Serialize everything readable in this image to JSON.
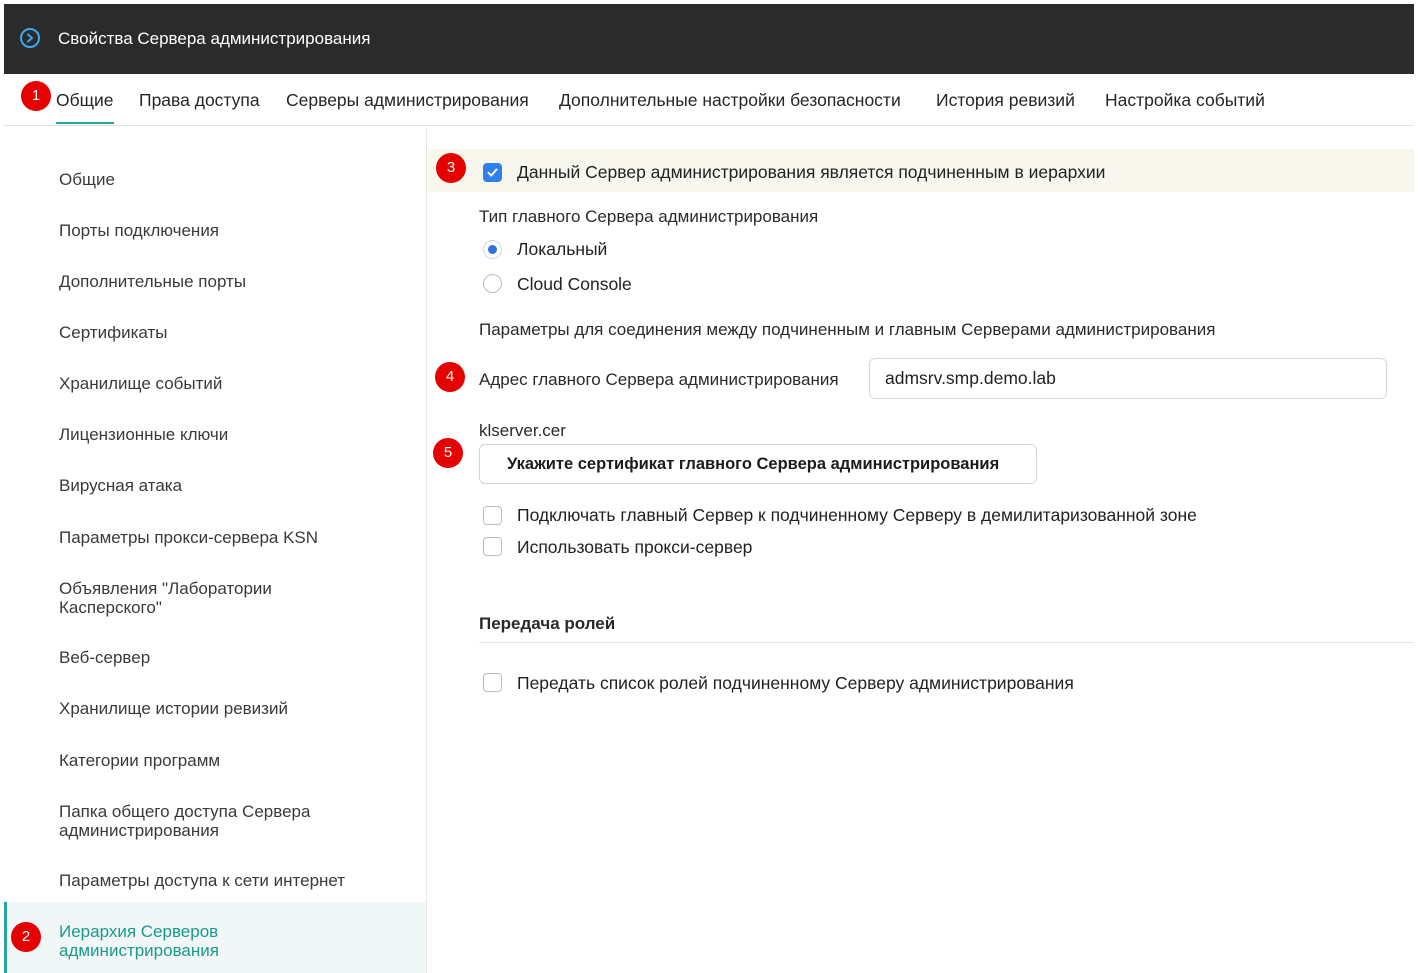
{
  "window": {
    "title": "Свойства Сервера администрирования"
  },
  "tabs": [
    {
      "label": "Общие",
      "active": true
    },
    {
      "label": "Права доступа"
    },
    {
      "label": "Серверы администрирования"
    },
    {
      "label": "Дополнительные настройки безопасности"
    },
    {
      "label": "История ревизий"
    },
    {
      "label": "Настройка событий"
    }
  ],
  "sidebar": {
    "items": [
      {
        "label": "Общие"
      },
      {
        "label": "Порты подключения"
      },
      {
        "label": "Дополнительные порты"
      },
      {
        "label": "Сертификаты"
      },
      {
        "label": "Хранилище событий"
      },
      {
        "label": "Лицензионные ключи"
      },
      {
        "label": "Вирусная атака"
      },
      {
        "label": "Параметры прокси-сервера KSN"
      },
      {
        "label": "Объявления \"Лаборатории Касперского\""
      },
      {
        "label": "Веб-сервер"
      },
      {
        "label": "Хранилище истории ревизий"
      },
      {
        "label": "Категории программ"
      },
      {
        "label": "Папка общего доступа Сервера администрирования"
      },
      {
        "label": "Параметры доступа к сети интернет"
      },
      {
        "label": "Иерархия Серверов администрирования",
        "active": true
      }
    ]
  },
  "content": {
    "secondary_checkbox": {
      "label": "Данный Сервер администрирования является подчиненным в иерархии",
      "checked": true
    },
    "master_type": {
      "heading": "Тип главного Сервера администрирования",
      "options": [
        {
          "label": "Локальный",
          "selected": true
        },
        {
          "label": "Cloud Console",
          "selected": false
        }
      ]
    },
    "connection_heading": "Параметры для соединения между подчиненным и главным Серверами администрирования",
    "master_address": {
      "label": "Адрес главного Сервера администрирования",
      "value": "admsrv.smp.demo.lab"
    },
    "certificate": {
      "file_name": "klserver.cer",
      "button_label": "Укажите сертификат главного Сервера администрирования"
    },
    "dmz_checkbox": {
      "label": "Подключать главный Сервер к подчиненному Серверу в демилитаризованной зоне",
      "checked": false
    },
    "proxy_checkbox": {
      "label": "Использовать прокси-сервер",
      "checked": false
    },
    "roles": {
      "heading": "Передача ролей",
      "checkbox": {
        "label": "Передать список ролей подчиненному Серверу администрирования",
        "checked": false
      }
    }
  },
  "markers": [
    "1",
    "2",
    "3",
    "4",
    "5"
  ],
  "colors": {
    "accent": "#26a69a",
    "titlebar": "#2b2b2b",
    "checkbox_blue": "#2f80ed",
    "marker_red": "#e60000"
  }
}
